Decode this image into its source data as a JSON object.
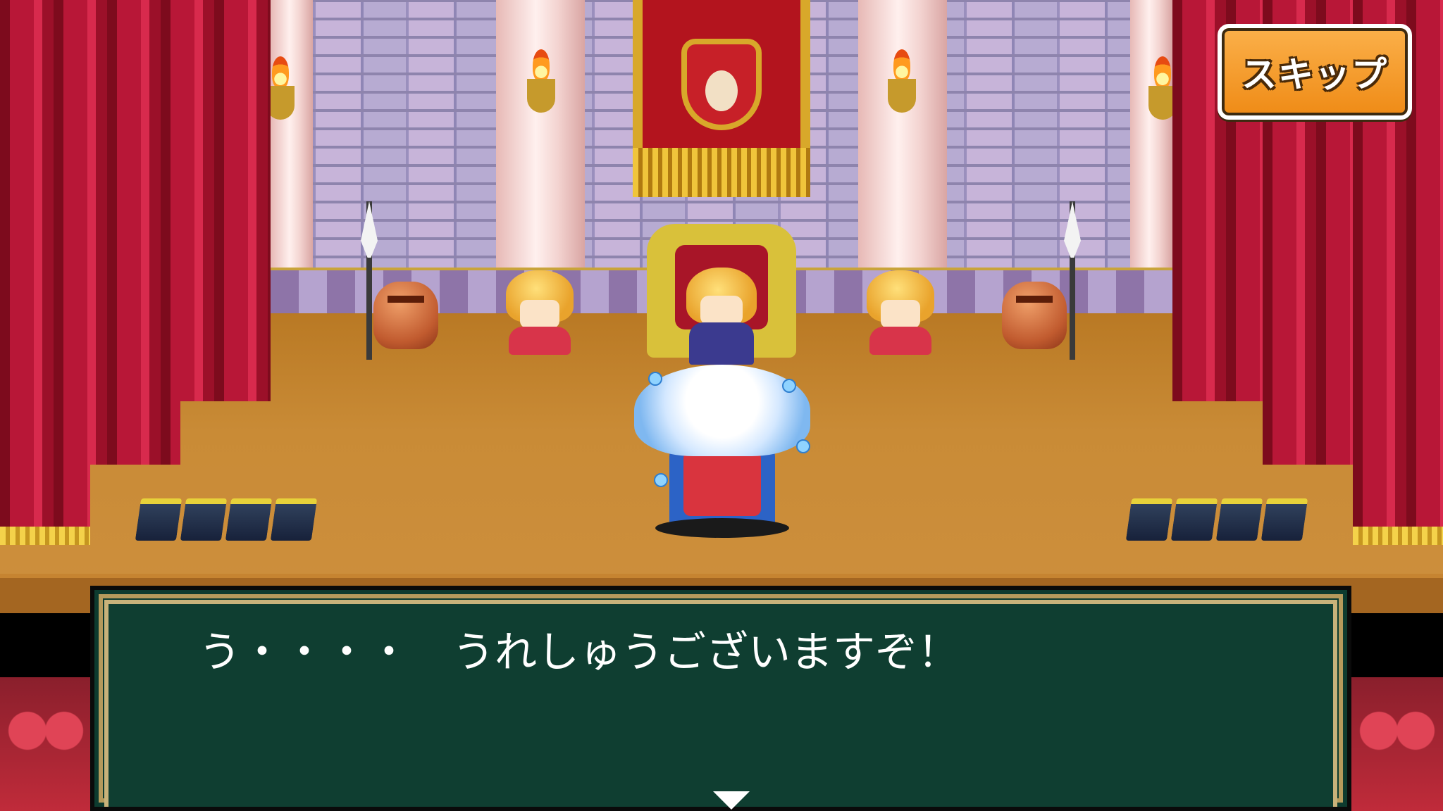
{
  "ui": {
    "skip_button_label": "スキップ"
  },
  "dialogue": {
    "text": "う・・・・　うれしゅうございますぞ！"
  },
  "colors": {
    "curtain": "#b81737",
    "floor": "#c98b36",
    "dialog_bg": "#0f3e31",
    "skip_button": "#ef8b16"
  },
  "icons": {
    "next_indicator": "down-triangle-icon"
  }
}
